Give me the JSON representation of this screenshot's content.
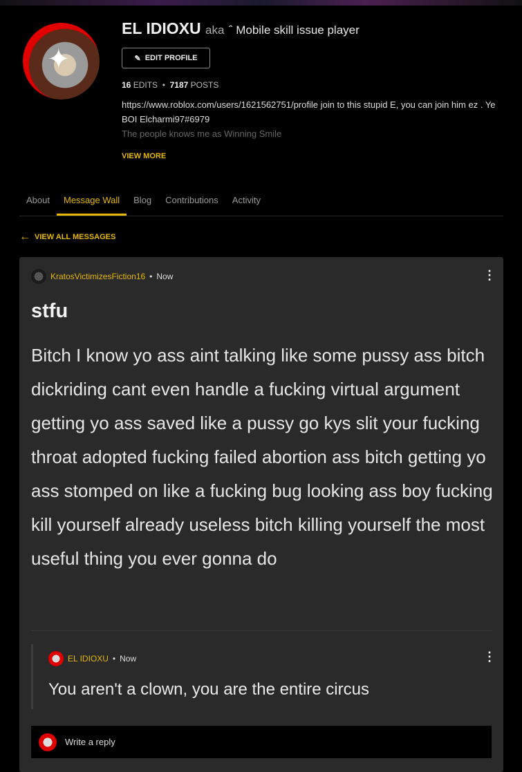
{
  "profile": {
    "name": "EL IDIOXU",
    "aka": "aka",
    "tagline": "ˆ Mobile skill issue player",
    "edit_label": "EDIT PROFILE",
    "edits": "16",
    "edits_label": "EDITS",
    "posts": "7187",
    "posts_label": "POSTS",
    "bio1": "https://www.roblox.com/users/1621562751/profile join to this stupid E, you can join him ez . Ye BOI Elcharmi97#6979",
    "bio2": "The people knows me as Winning Smile",
    "view_more": "VIEW MORE"
  },
  "tabs": [
    {
      "label": "About"
    },
    {
      "label": "Message Wall",
      "active": true
    },
    {
      "label": "Blog"
    },
    {
      "label": "Contributions"
    },
    {
      "label": "Activity"
    }
  ],
  "back_label": "VIEW ALL MESSAGES",
  "thread": {
    "author": "KratosVictimizesFiction16",
    "time": "Now",
    "title": "stfu",
    "body": "Bitch I know yo ass aint talking like some pussy ass bitch dickriding cant even handle a fucking virtual argument getting yo ass saved like a pussy go kys slit your fucking throat adopted fucking failed abortion ass bitch getting yo ass stomped on like a fucking bug looking ass boy fucking kill yourself already useless bitch killing yourself the most useful thing you ever gonna do",
    "reply": {
      "author": "EL IDIOXU",
      "time": "Now",
      "text": "You aren't a clown, you are the entire circus"
    },
    "write_reply": "Write a reply"
  },
  "colors": {
    "accent": "#e6b800",
    "card": "#2a2a2a",
    "background": "#000000"
  }
}
